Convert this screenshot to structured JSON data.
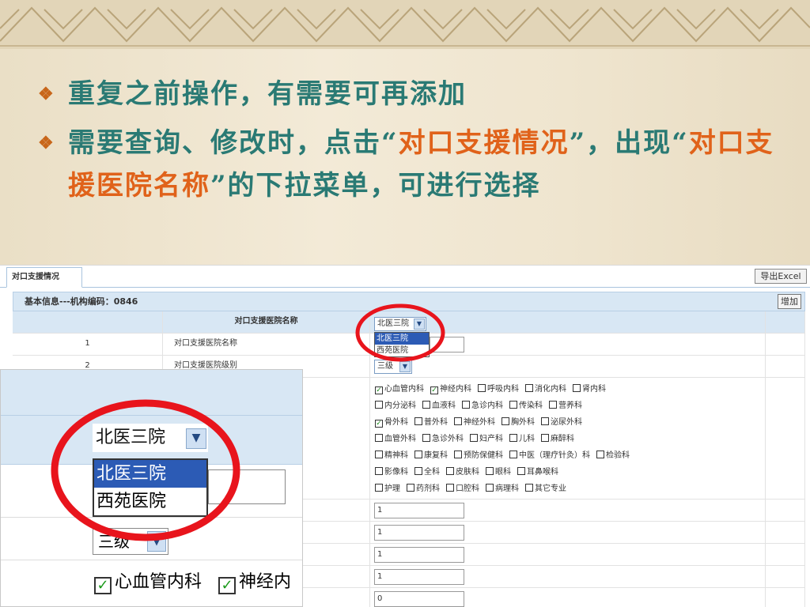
{
  "slide": {
    "bullets": [
      {
        "parts": [
          {
            "t": "重复之前操作，有需要可再添加",
            "accent": false
          }
        ]
      },
      {
        "parts": [
          {
            "t": "需要查询、修改时，点击“",
            "accent": false
          },
          {
            "t": "对口支援情况",
            "accent": true
          },
          {
            "t": "”，出现“",
            "accent": false
          },
          {
            "t": "对口支援医院名称",
            "accent": true
          },
          {
            "t": "”的下拉菜单，可进行选择",
            "accent": false
          }
        ]
      }
    ]
  },
  "app": {
    "tab_label": "对口支援情况",
    "export_label": "导出Excel",
    "info_bar": "基本信息---机构编码：0846",
    "add_label": "增加",
    "header_field": "对口支援医院名称",
    "hospital_select": {
      "value": "北医三院",
      "options": [
        "北医三院",
        "西苑医院"
      ]
    },
    "rows": [
      {
        "num": "1",
        "label": "对口支援医院名称"
      },
      {
        "num": "2",
        "label": "对口支援医院级别",
        "level": "三级"
      }
    ],
    "departments": [
      [
        {
          "n": "心血管内科",
          "c": true
        },
        {
          "n": "神经内科",
          "c": true
        },
        {
          "n": "呼吸内科",
          "c": false
        },
        {
          "n": "消化内科",
          "c": false
        },
        {
          "n": "肾内科",
          "c": false
        }
      ],
      [
        {
          "n": "内分泌科",
          "c": false
        },
        {
          "n": "血液科",
          "c": false
        },
        {
          "n": "急诊内科",
          "c": false
        },
        {
          "n": "传染科",
          "c": false
        },
        {
          "n": "营养科",
          "c": false
        }
      ],
      [
        {
          "n": "骨外科",
          "c": true
        },
        {
          "n": "普外科",
          "c": false
        },
        {
          "n": "神经外科",
          "c": false
        },
        {
          "n": "胸外科",
          "c": false
        },
        {
          "n": "泌尿外科",
          "c": false
        }
      ],
      [
        {
          "n": "血管外科",
          "c": false
        },
        {
          "n": "急诊外科",
          "c": false
        },
        {
          "n": "妇产科",
          "c": false
        },
        {
          "n": "儿科",
          "c": false
        },
        {
          "n": "麻醉科",
          "c": false
        }
      ],
      [
        {
          "n": "精神科",
          "c": false
        },
        {
          "n": "康复科",
          "c": false
        },
        {
          "n": "预防保健科",
          "c": false
        },
        {
          "n": "中医（理疗针灸）科",
          "c": false
        },
        {
          "n": "检验科",
          "c": false
        }
      ],
      [
        {
          "n": "影像科",
          "c": false
        },
        {
          "n": "全科",
          "c": false
        },
        {
          "n": "皮肤科",
          "c": false
        },
        {
          "n": "眼科",
          "c": false
        },
        {
          "n": "耳鼻喉科",
          "c": false
        }
      ],
      [
        {
          "n": "护理",
          "c": false
        },
        {
          "n": "药剂科",
          "c": false
        },
        {
          "n": "口腔科",
          "c": false
        },
        {
          "n": "病理科",
          "c": false
        },
        {
          "n": "其它专业",
          "c": false
        }
      ]
    ],
    "numeric_inputs": [
      "1",
      "1",
      "1",
      "1",
      "0"
    ]
  },
  "zoom": {
    "select_value": "北医三院",
    "options": [
      "北医三院",
      "西苑医院"
    ],
    "level_value": "三级",
    "checks": [
      {
        "n": "心血管内科",
        "c": true
      },
      {
        "n": "神经内",
        "c": true
      }
    ]
  },
  "colors": {
    "bullet_text": "#2a7a74",
    "accent": "#e0621a",
    "highlight_circle": "#e8141c",
    "selected_option": "#2c5bb5"
  }
}
